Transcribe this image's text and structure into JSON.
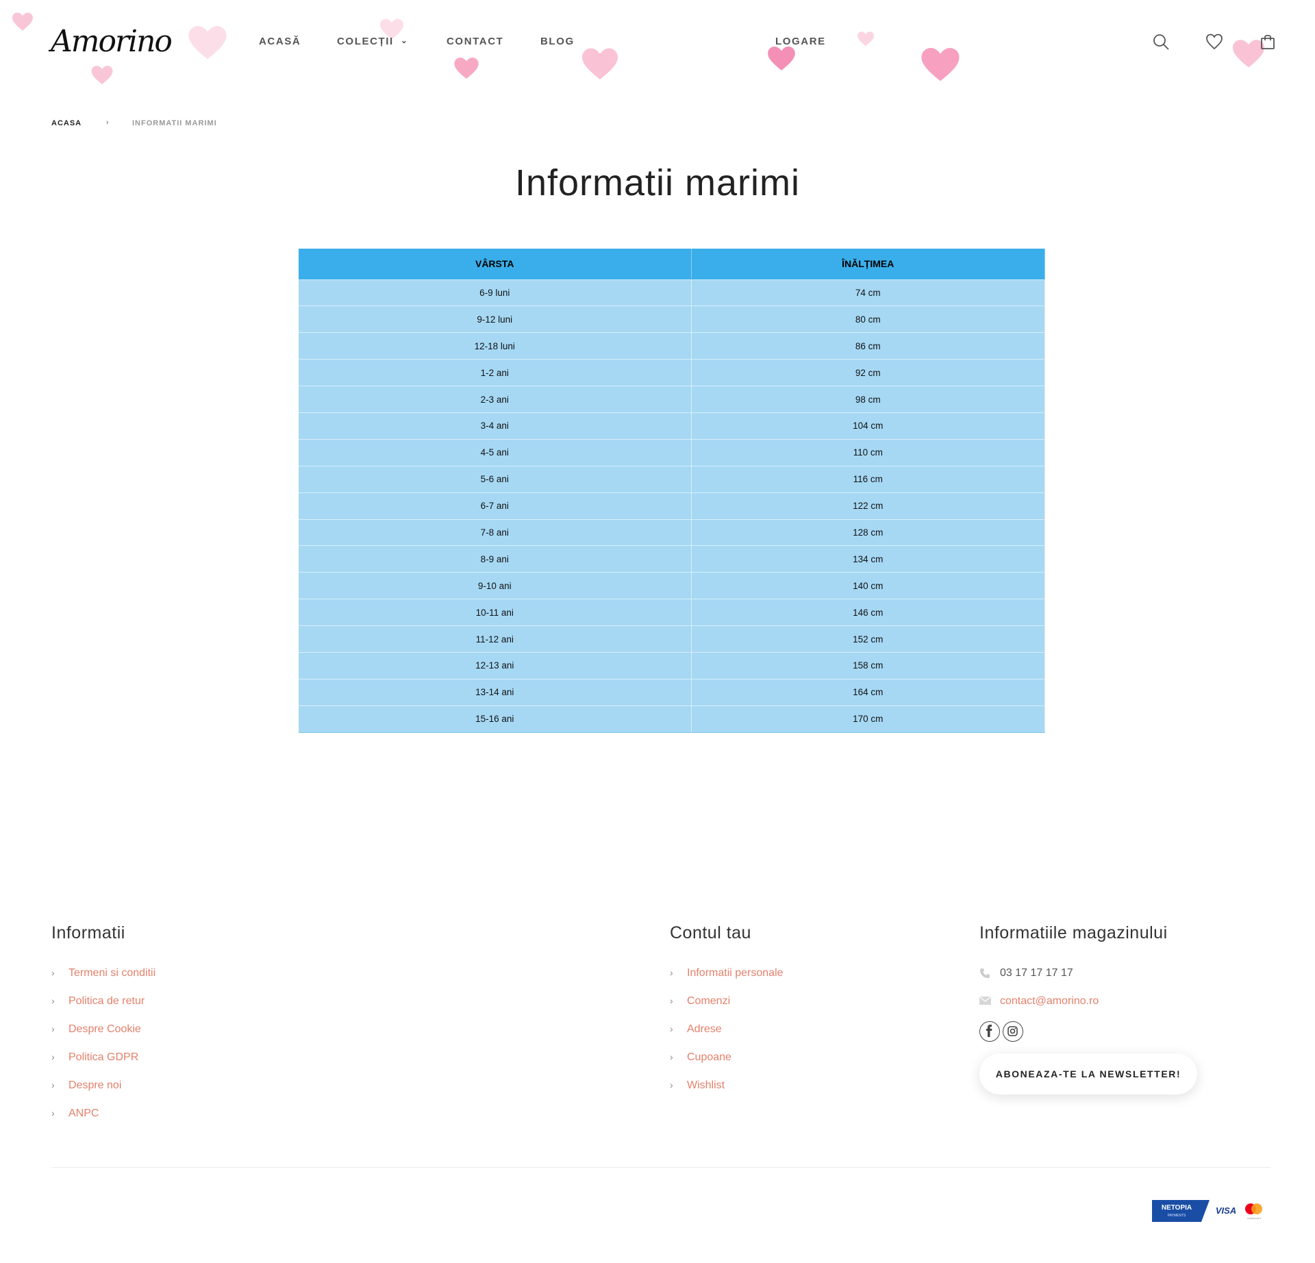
{
  "header": {
    "logo_text": "Amorino",
    "nav": [
      {
        "label": "ACASĂ"
      },
      {
        "label": "COLECȚII"
      },
      {
        "label": "CONTACT"
      },
      {
        "label": "BLOG"
      },
      {
        "label": "LOGARE"
      }
    ],
    "icons": [
      "search-icon",
      "heart-icon",
      "shopping-bag-icon"
    ],
    "decor_color": "#f7a9c4"
  },
  "breadcrumb": {
    "home": "ACASA",
    "separator": "›",
    "current": "INFORMATII MARIMI"
  },
  "page": {
    "title": "Informatii marimi"
  },
  "size_table": {
    "headers": [
      "VÂRSTA",
      "ÎNĂLȚIMEA"
    ],
    "header_color": "#3aaeea",
    "row_color": "#a6d8f4",
    "rows": [
      [
        "6-9 luni",
        "74 cm"
      ],
      [
        "9-12 luni",
        "80 cm"
      ],
      [
        "12-18 luni",
        "86 cm"
      ],
      [
        "1-2 ani",
        "92 cm"
      ],
      [
        "2-3 ani",
        "98 cm"
      ],
      [
        "3-4 ani",
        "104 cm"
      ],
      [
        "4-5 ani",
        "110 cm"
      ],
      [
        "5-6 ani",
        "116 cm"
      ],
      [
        "6-7 ani",
        "122 cm"
      ],
      [
        "7-8 ani",
        "128 cm"
      ],
      [
        "8-9 ani",
        "134 cm"
      ],
      [
        "9-10 ani",
        "140 cm"
      ],
      [
        "10-11 ani",
        "146 cm"
      ],
      [
        "11-12 ani",
        "152 cm"
      ],
      [
        "12-13 ani",
        "158 cm"
      ],
      [
        "13-14 ani",
        "164 cm"
      ],
      [
        "15-16 ani",
        "170 cm"
      ]
    ]
  },
  "footer": {
    "link_color": "#e3806b",
    "informatii": {
      "title": "Informatii",
      "links": [
        "Termeni si conditii",
        "Politica de retur",
        "Despre Cookie",
        "Politica GDPR",
        "Despre noi",
        "ANPC"
      ]
    },
    "contul_tau": {
      "title": "Contul tau",
      "links": [
        "Informatii personale",
        "Comenzi",
        "Adrese",
        "Cupoane",
        "Wishlist"
      ]
    },
    "magazin": {
      "title": "Informatiile magazinului",
      "phone": "03 17 17 17 17",
      "email": "contact@amorino.ro",
      "social": [
        "facebook-icon",
        "instagram-icon"
      ],
      "newsletter": "ABONEAZA-TE LA NEWSLETTER!"
    },
    "payments": {
      "netopia": "NETOPIA",
      "netopia_sub": "PAYMENTS",
      "visa": "VISA",
      "mastercard": "mastercard"
    }
  }
}
